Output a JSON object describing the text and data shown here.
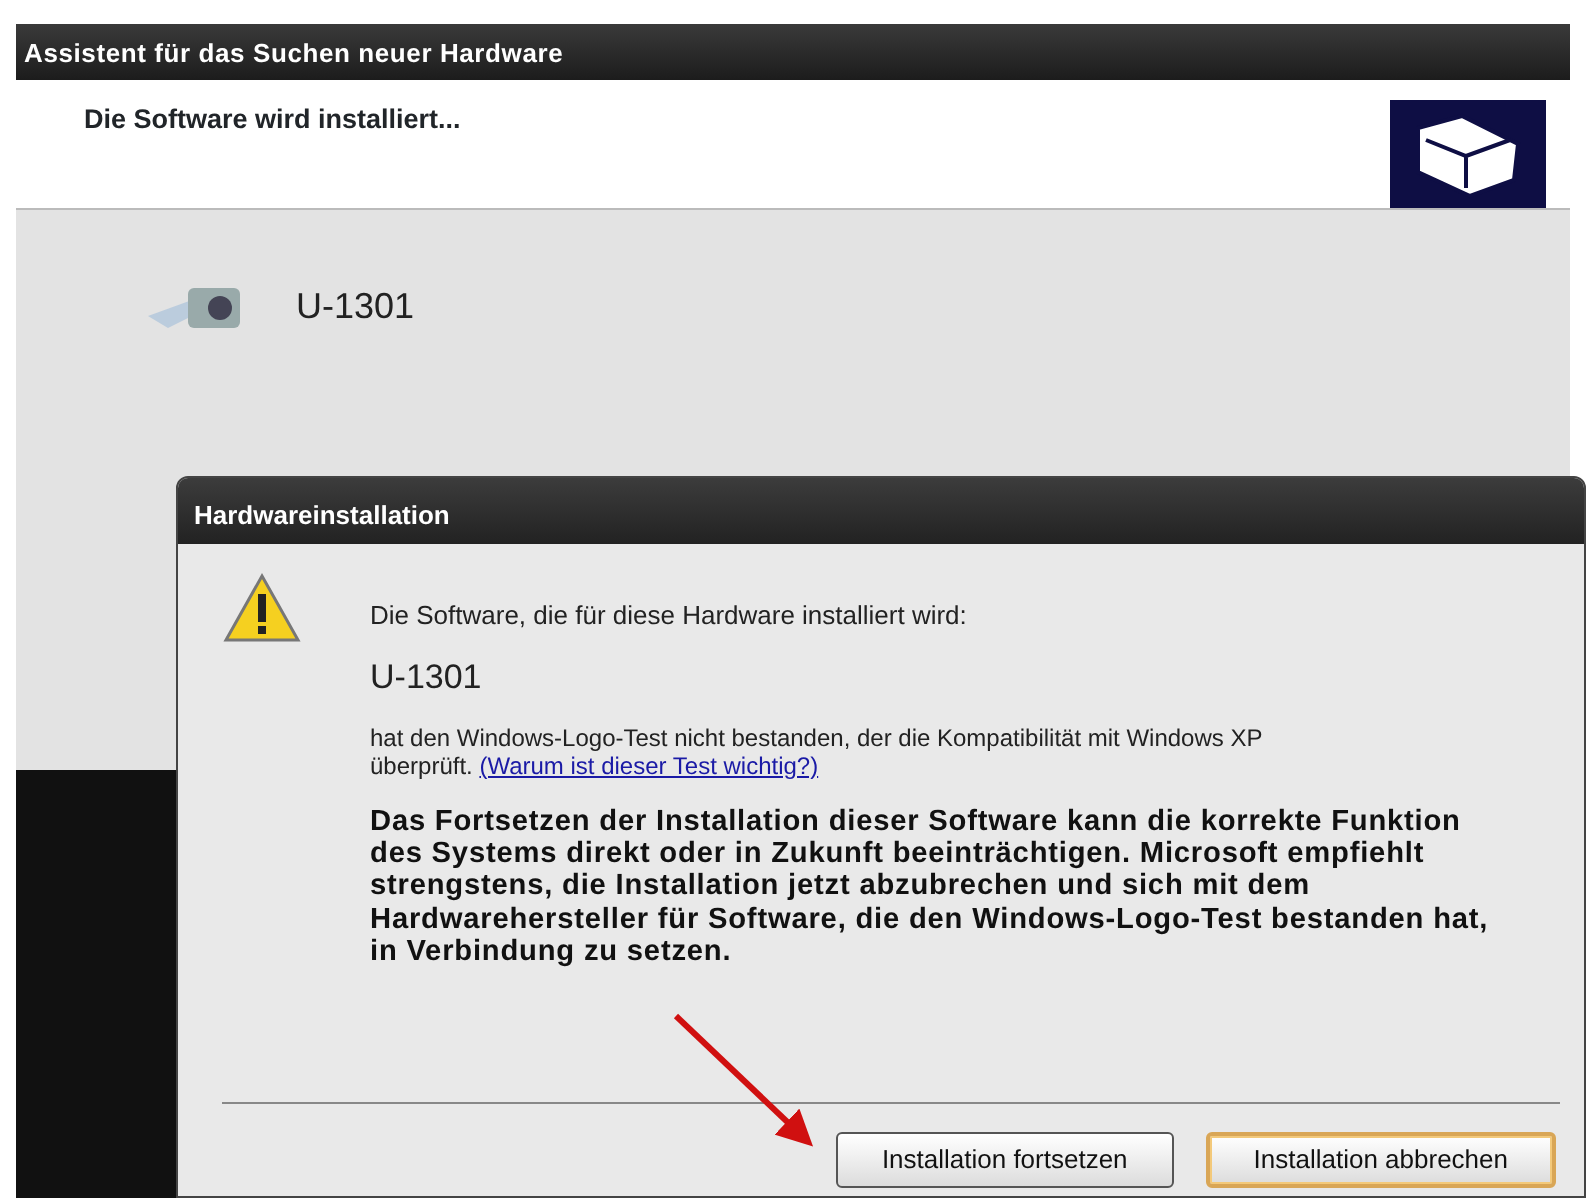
{
  "wizard": {
    "title": "Assistent für das Suchen neuer Hardware",
    "heading": "Die Software wird installiert...",
    "device": "U-1301"
  },
  "dialog": {
    "title": "Hardwareinstallation",
    "intro": "Die Software, die für diese Hardware installiert wird:",
    "device": "U-1301",
    "notice": "hat den Windows-Logo-Test nicht bestanden, der die Kompatibilität mit Windows XP überprüft.",
    "link": "(Warum ist dieser Test wichtig?)",
    "warning": "Das Fortsetzen der Installation dieser Software kann die korrekte Funktion des Systems direkt oder in Zukunft beeinträchtigen. Microsoft empfiehlt strengstens, die Installation jetzt abzubrechen und sich mit dem Hardwarehersteller für Software, die den Windows-Logo-Test bestanden hat, in Verbindung zu setzen.",
    "buttons": [
      {
        "label": "Installation fortsetzen",
        "default": false
      },
      {
        "label": "Installation abbrechen",
        "default": true
      }
    ]
  }
}
